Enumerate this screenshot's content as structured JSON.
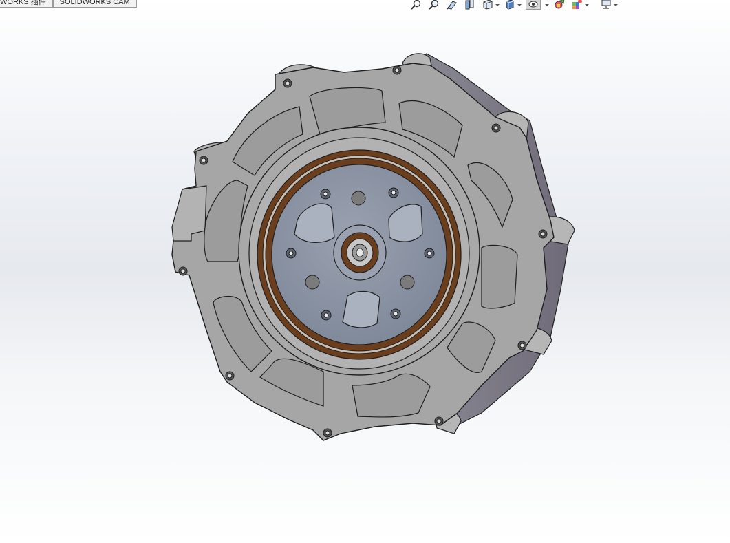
{
  "tabs": [
    {
      "label": "WORKS 插件"
    },
    {
      "label": "SOLIDWORKS CAM"
    }
  ],
  "toolbar": {
    "buttons": [
      {
        "icon": "zoom-to-fit-icon"
      },
      {
        "icon": "zoom-to-area-icon"
      },
      {
        "icon": "previous-view-icon"
      },
      {
        "icon": "section-view-icon"
      },
      {
        "icon": "view-orientation-icon"
      },
      {
        "icon": "display-style-icon"
      },
      {
        "icon": "hide-show-items-icon"
      },
      {
        "icon": "edit-appearance-icon"
      },
      {
        "icon": "apply-scene-icon"
      },
      {
        "icon": "view-settings-icon"
      }
    ],
    "accent_color": "#3a7bd5"
  },
  "model": {
    "housing_color": "#a3a3a3",
    "rotor_color": "#8e97a7",
    "ring_color": "#6b3f1d"
  }
}
